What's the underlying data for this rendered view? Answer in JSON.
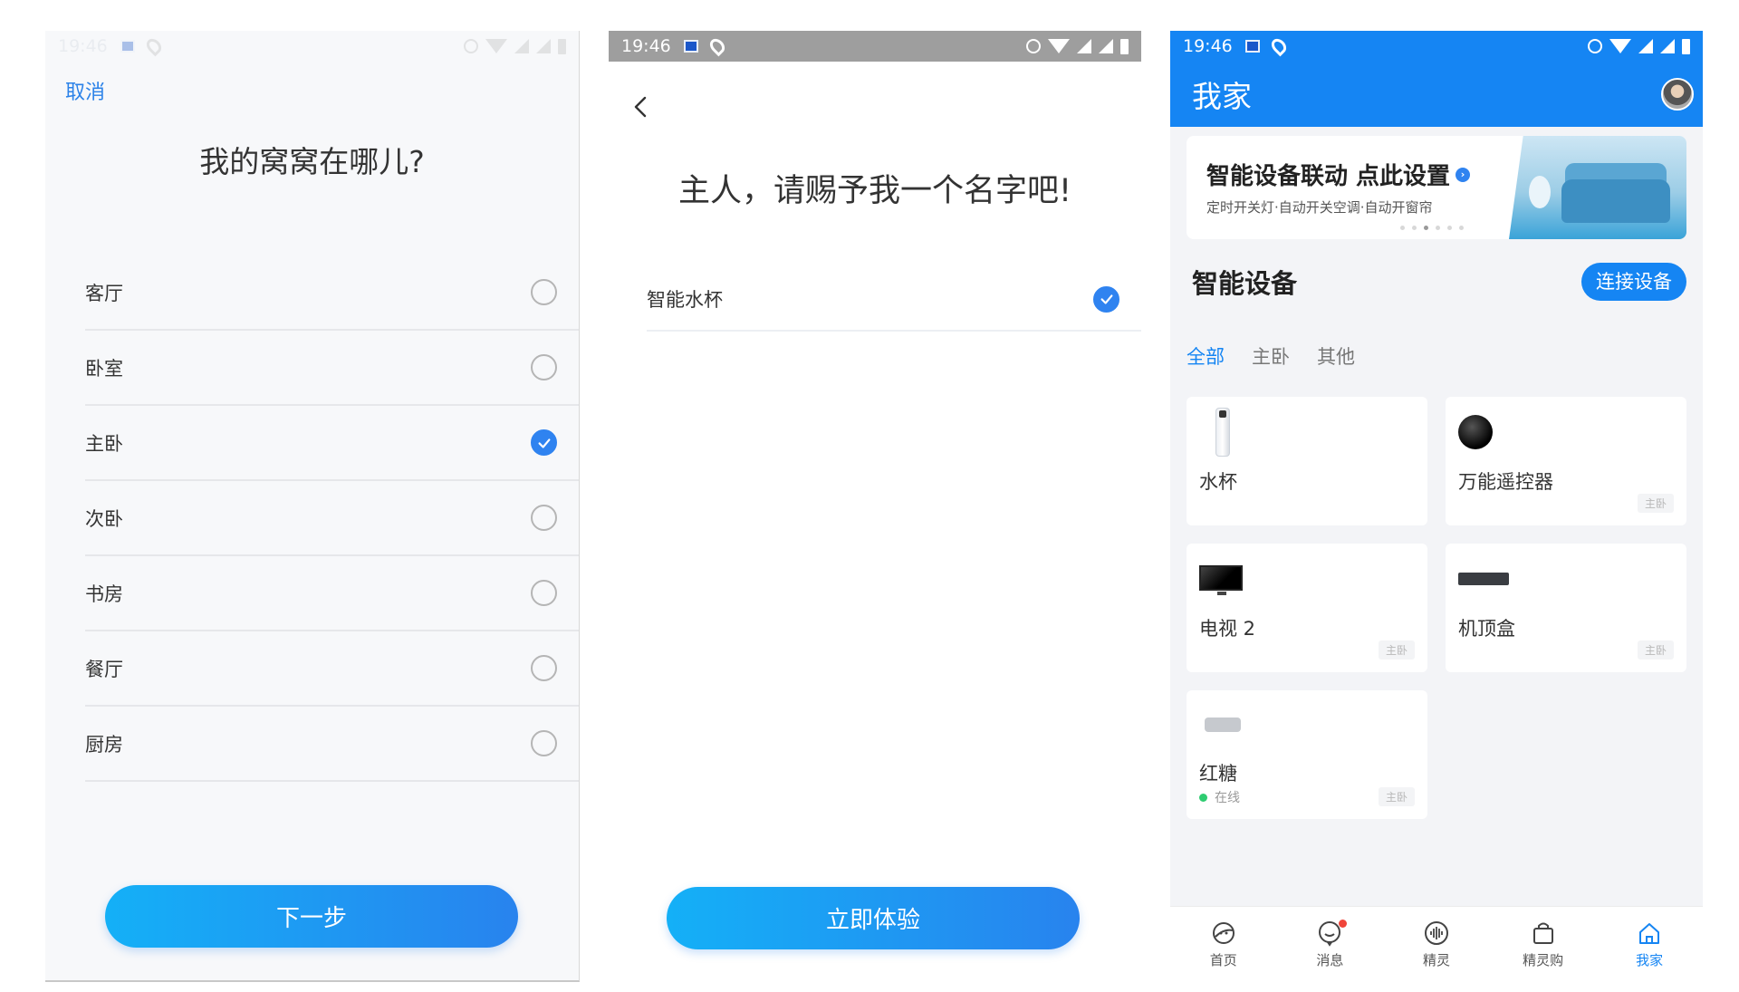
{
  "status_bar": {
    "time": "19:46"
  },
  "screen1": {
    "cancel_label": "取消",
    "title": "我的窝窝在哪儿?",
    "rooms": [
      {
        "label": "客厅",
        "selected": false
      },
      {
        "label": "卧室",
        "selected": false
      },
      {
        "label": "主卧",
        "selected": true
      },
      {
        "label": "次卧",
        "selected": false
      },
      {
        "label": "书房",
        "selected": false
      },
      {
        "label": "餐厅",
        "selected": false
      },
      {
        "label": "厨房",
        "selected": false
      }
    ],
    "next_label": "下一步"
  },
  "screen2": {
    "title": "主人，请赐予我一个名字吧!",
    "name_option": "智能水杯",
    "name_selected": true,
    "cta_label": "立即体验"
  },
  "screen3": {
    "header_title": "我家",
    "banner": {
      "title": "智能设备联动 点此设置",
      "subtitle": "定时开关灯·自动开关空调·自动开窗帘",
      "page_count": 6,
      "active_page": 2
    },
    "section_title": "智能设备",
    "connect_label": "连接设备",
    "tabs": [
      {
        "label": "全部",
        "active": true
      },
      {
        "label": "主卧",
        "active": false
      },
      {
        "label": "其他",
        "active": false
      }
    ],
    "devices": [
      {
        "name": "水杯",
        "icon": "cup-icon",
        "tag": "",
        "status": ""
      },
      {
        "name": "万能遥控器",
        "icon": "remote-icon",
        "tag": "主卧",
        "status": ""
      },
      {
        "name": "电视 2",
        "icon": "tv-icon",
        "tag": "主卧",
        "status": ""
      },
      {
        "name": "机顶盒",
        "icon": "settop-box-icon",
        "tag": "主卧",
        "status": ""
      },
      {
        "name": "红糖",
        "icon": "hongtang-icon",
        "tag": "主卧",
        "status": "在线"
      }
    ],
    "bottom_tabs": [
      {
        "label": "首页",
        "icon": "home-planet-icon",
        "active": false
      },
      {
        "label": "消息",
        "icon": "message-icon",
        "active": false,
        "badge": true
      },
      {
        "label": "精灵",
        "icon": "voice-icon",
        "active": false
      },
      {
        "label": "精灵购",
        "icon": "shopping-bag-icon",
        "active": false
      },
      {
        "label": "我家",
        "icon": "house-icon",
        "active": true
      }
    ],
    "colors": {
      "accent": "#1585f3",
      "online": "#2ecc71"
    }
  }
}
